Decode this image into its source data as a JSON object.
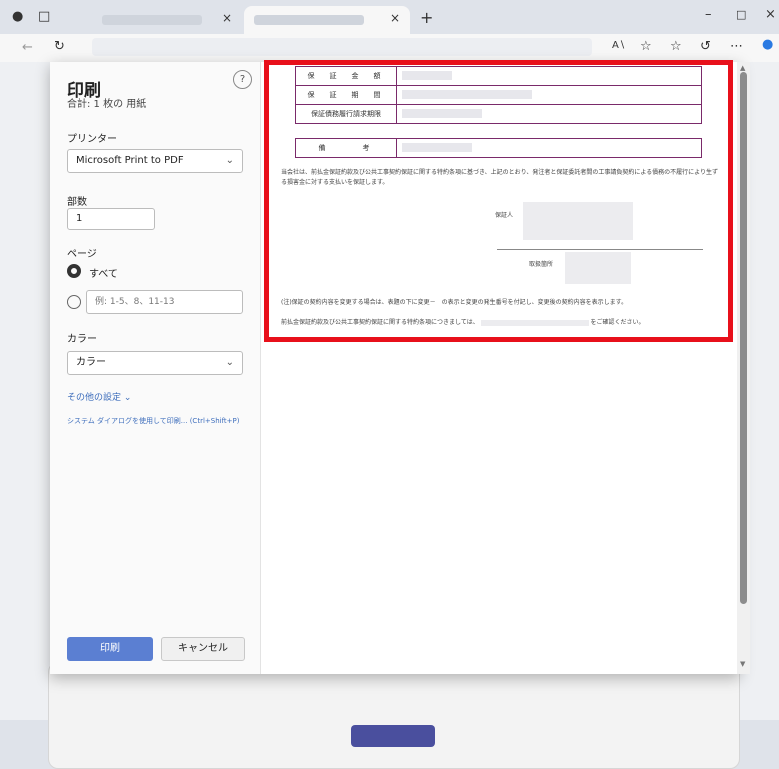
{
  "browser": {
    "new_tab": "+",
    "close": "×"
  },
  "dialog": {
    "title": "印刷",
    "subtitle": "合計: 1 枚の 用紙",
    "help": "?",
    "printer_label": "プリンター",
    "printer_value": "Microsoft Print to PDF",
    "copies_label": "部数",
    "copies_value": "1",
    "pages_label": "ページ",
    "pages_all": "すべて",
    "pages_range_placeholder": "例: 1-5、8、11-13",
    "color_label": "カラー",
    "color_value": "カラー",
    "more_settings": "その他の設定 ⌄",
    "system_dialog": "システム ダイアログを使用して印刷... (Ctrl+Shift+P)",
    "print_button": "印刷",
    "cancel_button": "キャンセル"
  },
  "preview": {
    "rows": [
      "保　証　金　額",
      "保　証　期　間",
      "保証債務履行請求期限"
    ],
    "remarks": "備　　　考",
    "paragraph": "当会社は、前払金保証約款及び公共工事契約保証に関する特約条項に基づき、上記のとおり、発注者と保証委託者間の工事請負契約による債務の不履行により生ずる損害金に対する支払いを保証します。",
    "guarantor": "保証人",
    "office": "取扱箇所",
    "note1": "(注)保証の契約内容を変更する場合は、表題の下に変更－　の表示と変更の発生番号を付記し、変更後の契約内容を表示します。",
    "note2_prefix": "前払金保証約款及び公共工事契約保証に関する特約条項につきましては、",
    "note2_suffix": "をご確認ください。"
  },
  "colors": {
    "highlight": "#e8101b",
    "primary": "#5b7fd2",
    "link": "#3e6ebc"
  }
}
